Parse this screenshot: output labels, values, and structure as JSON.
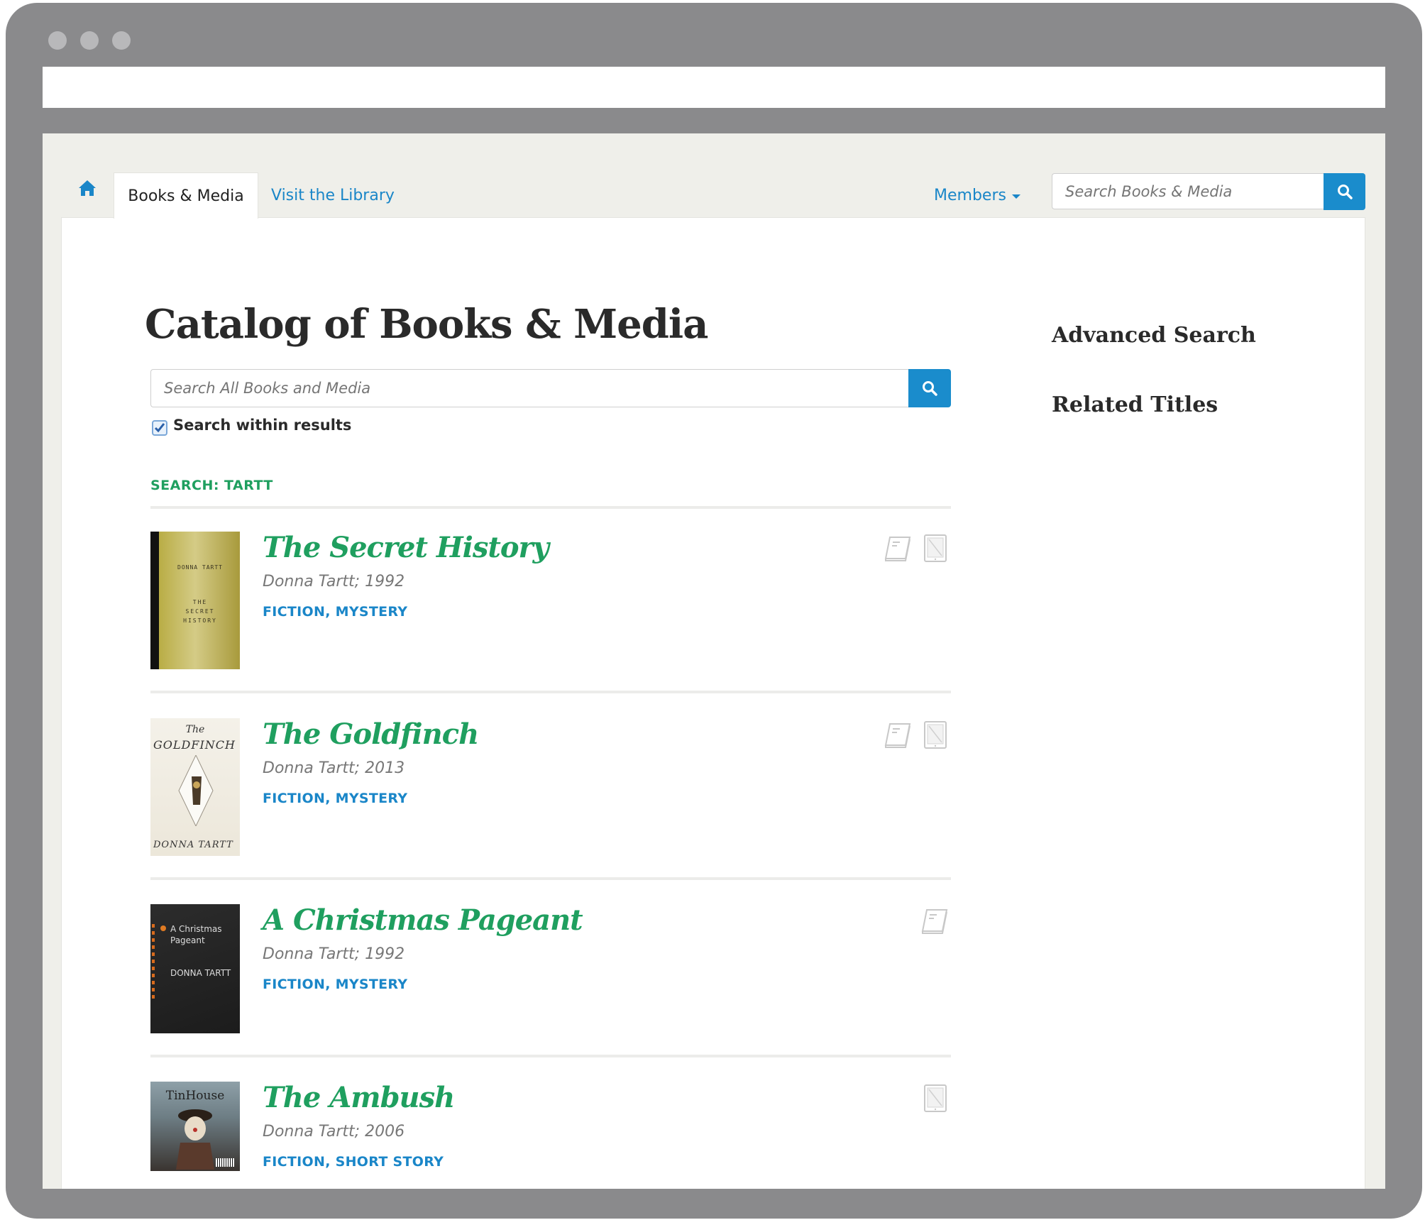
{
  "nav": {
    "home_label": "Home",
    "tabs": [
      {
        "label": "Books & Media",
        "active": true
      },
      {
        "label": "Visit the Library",
        "active": false
      }
    ],
    "members_label": "Members",
    "search_placeholder": "Search Books & Media"
  },
  "main": {
    "title": "Catalog of Books & Media",
    "search_placeholder": "Search All Books and Media",
    "within_results_label": "Search within results",
    "within_results_checked": true,
    "search_query_label": "SEARCH: TARTT"
  },
  "results": [
    {
      "title": "The Secret History",
      "meta": "Donna Tartt; 1992",
      "tags": [
        "FICTION",
        "MYSTERY"
      ],
      "formats": [
        "book-icon",
        "ebook-icon"
      ],
      "cover_text": [
        "DONNA TARTT",
        "THE",
        "SECRET",
        "HISTORY"
      ]
    },
    {
      "title": "The Goldfinch",
      "meta": "Donna Tartt; 2013",
      "tags": [
        "FICTION",
        "MYSTERY"
      ],
      "formats": [
        "book-icon",
        "ebook-icon"
      ],
      "cover_text": [
        "The",
        "GOLDFINCH",
        "DONNA TARTT"
      ]
    },
    {
      "title": "A Christmas Pageant",
      "meta": "Donna Tartt; 1992",
      "tags": [
        "FICTION",
        "MYSTERY"
      ],
      "formats": [
        "book-icon"
      ],
      "cover_text": [
        "A Christmas",
        "Pageant",
        "DONNA TARTT"
      ]
    },
    {
      "title": "The Ambush",
      "meta": "Donna Tartt; 2006",
      "tags": [
        "FICTION",
        "SHORT STORY"
      ],
      "formats": [
        "ebook-icon"
      ],
      "cover_text": [
        "TinHouse"
      ]
    }
  ],
  "sidebar": {
    "advanced_search": "Advanced Search",
    "related_titles": "Related Titles"
  },
  "colors": {
    "accent_blue": "#1a8ccc",
    "title_green": "#1f9f5f",
    "frame_gray": "#8a8a8c"
  }
}
